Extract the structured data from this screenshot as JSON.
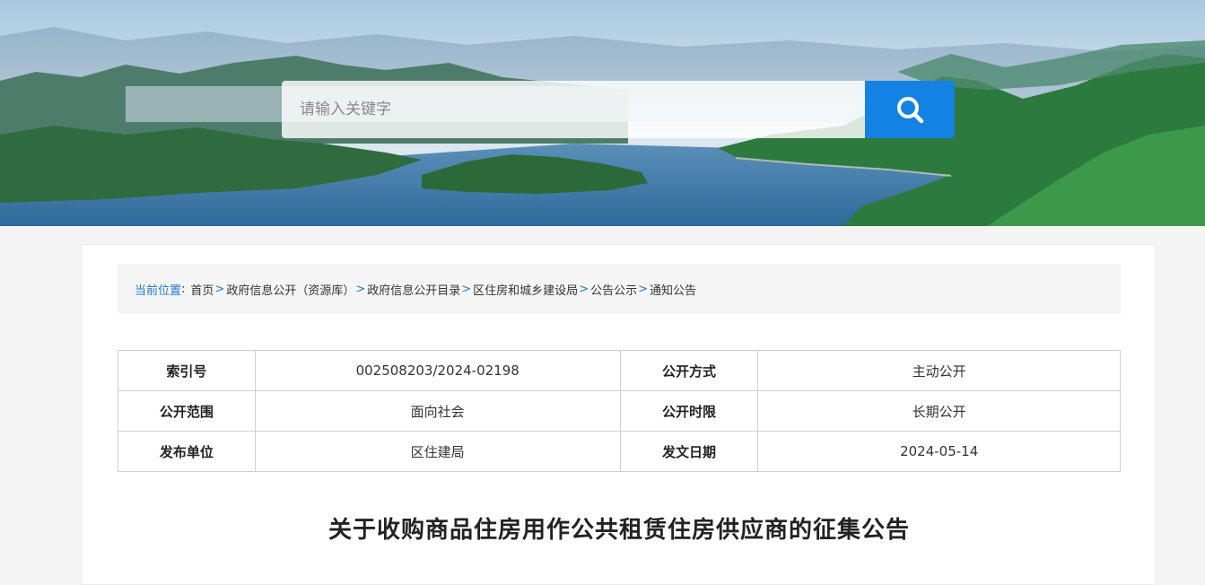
{
  "search": {
    "placeholder": "请输入关键字",
    "button_icon": "search-icon"
  },
  "colors": {
    "accent": "#1482e2",
    "breadcrumb_link": "#1f7bd1"
  },
  "breadcrumb": {
    "label": "当前位置",
    "colon": ":",
    "items": [
      {
        "text": "首页",
        "sep": ">"
      },
      {
        "text": "政府信息公开（资源库）",
        "sep": ">"
      },
      {
        "text": "政府信息公开目录",
        "sep": ">"
      },
      {
        "text": "区住房和城乡建设局",
        "sep": ">"
      },
      {
        "text": "公告公示",
        "sep": ">"
      },
      {
        "text": "通知公告",
        "sep": ""
      }
    ]
  },
  "meta_table": {
    "rows": [
      {
        "k1": "索引号",
        "v1": "002508203/2024-02198",
        "k2": "公开方式",
        "v2": "主动公开"
      },
      {
        "k1": "公开范围",
        "v1": "面向社会",
        "k2": "公开时限",
        "v2": "长期公开"
      },
      {
        "k1": "发布单位",
        "v1": "区住建局",
        "k2": "发文日期",
        "v2": "2024-05-14"
      }
    ]
  },
  "document": {
    "title": "关于收购商品住房用作公共租赁住房供应商的征集公告"
  }
}
